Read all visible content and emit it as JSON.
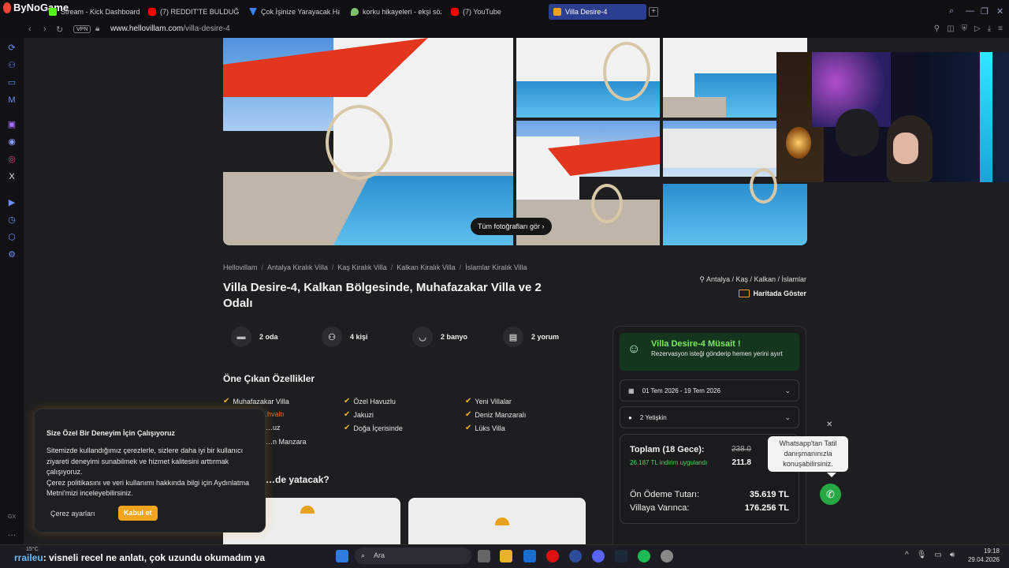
{
  "browser": {
    "brand": "ByNoGame",
    "tabs": [
      {
        "label": "Stream - Kick Dashboard",
        "color": "#53fc18"
      },
      {
        "label": "(7) REDDIT'TE BULDUĞUM",
        "color": "#ff0000"
      },
      {
        "label": "Çok İşinize Yarayacak Haf",
        "color": "#3b82f6"
      },
      {
        "label": "korku hikayeleri - ekşi söz",
        "color": "#7cc26a"
      },
      {
        "label": "(7) YouTube",
        "color": "#ff0000"
      },
      {
        "label": "Villa Desire-4",
        "color": "#f0a020"
      }
    ],
    "vpn": "VPN",
    "url_domain": "www.hellovillam.com",
    "url_path": "/villa-desire-4"
  },
  "gallery": {
    "button_label": "Tüm fotoğrafları gör"
  },
  "breadcrumbs": [
    "Hellovillam",
    "Antalya Kiralık Villa",
    "Kaş Kiralık Villa",
    "Kalkan Kiralık Villa",
    "İslamlar Kiralık Villa"
  ],
  "listing": {
    "title": "Villa Desire-4, Kalkan Bölgesinde, Muhafazakar Villa ve 2 Odalı",
    "location": "Antalya / Kaş / Kalkan / İslamlar",
    "map_link": "Haritada Göster",
    "features": [
      {
        "label": "2 oda",
        "icon": "bed-icon"
      },
      {
        "label": "4 kişi",
        "icon": "people-icon"
      },
      {
        "label": "2 banyo",
        "icon": "bathtub-icon"
      },
      {
        "label": "2 yorum",
        "icon": "comment-icon"
      }
    ],
    "amenities_title": "Öne Çıkan Özellikler",
    "amenities": [
      "Muhafazakar Villa",
      "Özel Havuzlu",
      "Yeni Villalar",
      "…hvaltı",
      "Jakuzi",
      "Deniz Manzaralı",
      "…uz",
      "Doğa İçerisinde",
      "Lüks Villa",
      "…n Manzara"
    ],
    "sleep_title": "…de yatacak?"
  },
  "booking": {
    "avail_title": "Villa Desire-4 Müsait !",
    "avail_sub": "Rezervasyon isteği gönderip hemen yerini ayırt",
    "dates": "01 Tem 2026 - 19 Tem 2026",
    "guests": "2 Yetişkin",
    "total_label": "Toplam (18 Gece):",
    "discount": "26.187 TL indirim uygulandı",
    "old_price": "238.0",
    "new_price": "211.8",
    "prepay_label": "Ön Ödeme Tutarı:",
    "prepay_value": "35.619 TL",
    "arrival_label": "Villaya Varınca:",
    "arrival_value": "176.256 TL"
  },
  "whatsapp": {
    "tooltip": "Whatsapp'tan Tatil danışmanınızla konuşabilirsiniz."
  },
  "cookie": {
    "title": "Size Özel Bir Deneyim İçin Çalışıyoruz",
    "body1": "Sitemizde kullandığımız çerezlerle, sizlere daha iyi bir kullanıcı ziyareti deneyimi sunabilmek ve hizmet kalitesini arttırmak çalışıyoruz.",
    "body2": "Çerez politikasını ve veri kullanımı hakkında bilgi için Aydınlatma Metni'mizi inceleyebilirsiniz.",
    "settings": "Çerez ayarları",
    "accept": "Kabul et"
  },
  "taskbar": {
    "weather": "15°C",
    "search": "Ara",
    "time": "19:18",
    "date": "29.04.2026",
    "chat_user": "rraileu",
    "chat_msg": ": visneli recel ne anlatı, çok uzundu okumadım ya"
  },
  "sidebar_badge": "GX"
}
